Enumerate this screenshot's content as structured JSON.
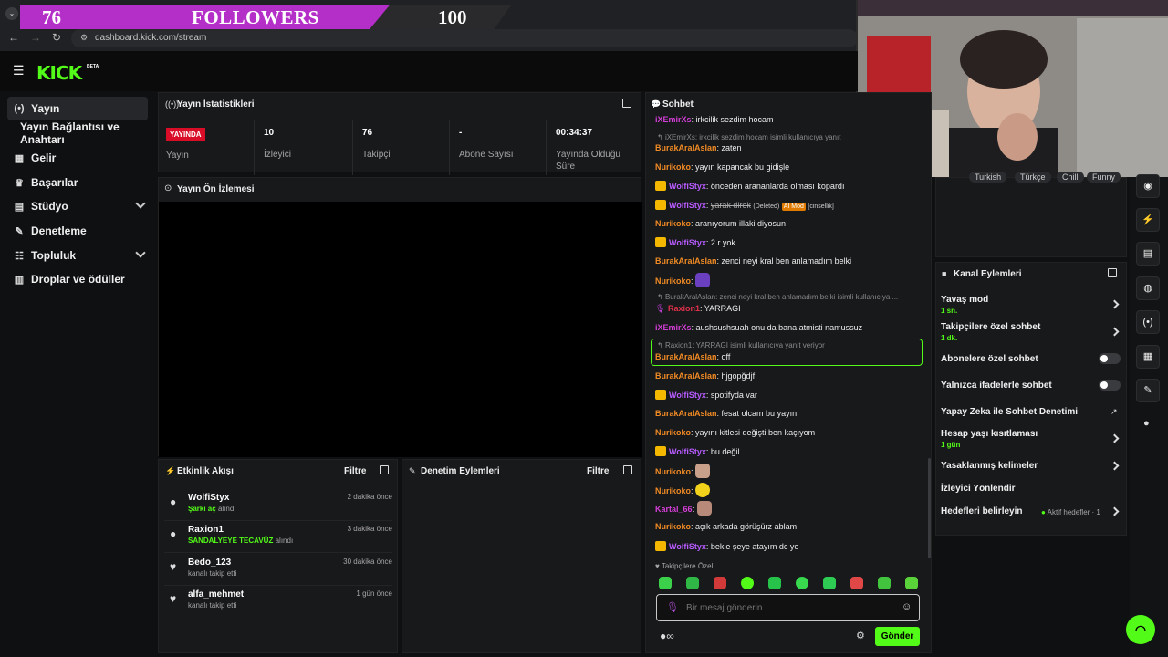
{
  "overlay": {
    "count_current": "76",
    "label": "FOLLOWERS",
    "count_goal": "100"
  },
  "browser": {
    "url": "dashboard.kick.com/stream"
  },
  "sidebar": {
    "items": [
      {
        "label": "Yayın"
      },
      {
        "label": "Yayın Bağlantısı ve Anahtarı"
      },
      {
        "label": "Gelir"
      },
      {
        "label": "Başarılar"
      },
      {
        "label": "Stüdyo"
      },
      {
        "label": "Denetleme"
      },
      {
        "label": "Topluluk"
      },
      {
        "label": "Droplar ve ödüller"
      }
    ]
  },
  "stats": {
    "title": "Yayın İstatistikleri",
    "live_badge": "YAYINDA",
    "live_label": "Yayın",
    "viewers_value": "10",
    "viewers_label": "İzleyici",
    "followers_value": "76",
    "followers_label": "Takipçi",
    "subs_value": "-",
    "subs_label": "Abone Sayısı",
    "uptime_value": "00:34:37",
    "uptime_label": "Yayında Olduğu Süre"
  },
  "preview": {
    "title": "Yayın Ön İzlemesi"
  },
  "activity": {
    "title": "Etkinlik Akışı",
    "filter": "Filtre",
    "items": [
      {
        "name": "WolfiStyx",
        "highlight": "Şarkı aç",
        "suffix": "alındı",
        "time": "2 dakika önce"
      },
      {
        "name": "Raxion1",
        "highlight": "SANDALYEYE TECAVÜZ",
        "suffix": "alındı",
        "time": "3 dakika önce"
      },
      {
        "name": "Bedo_123",
        "highlight": "",
        "suffix": "kanalı takip etti",
        "time": "30 dakika önce"
      },
      {
        "name": "alfa_mehmet",
        "highlight": "",
        "suffix": "kanalı takip etti",
        "time": "1 gün önce"
      }
    ]
  },
  "moderation": {
    "title": "Denetim Eylemleri",
    "filter": "Filtre"
  },
  "chat": {
    "title": "Sohbet",
    "lines": [
      {
        "user": "iXEmirXs",
        "text": ": irkcilik sezdim hocam"
      },
      {
        "reply": "iXEmirXs: irkcilik sezdim hocam isimli kullanıcıya yanıt"
      },
      {
        "user": "BurakAralAslan",
        "text": ": zaten"
      },
      {
        "user": "Nurikoko",
        "text": ": yayın kapancak bu gidişle"
      },
      {
        "user": "WolfiStyx",
        "text": ": önceden arananlarda olması kopardı"
      },
      {
        "user": "WolfiStyx",
        "text": "yarak direk",
        "deleted": "(Deleted)",
        "ai": "AI Mod",
        "cat": "[cinsellik]"
      },
      {
        "user": "Nurikoko",
        "text": ": aranıyorum illaki diyosun"
      },
      {
        "user": "WolfiStyx",
        "text": ": 2 r yok"
      },
      {
        "user": "BurakAralAslan",
        "text": ": zenci neyi kral ben anlamadım belki"
      },
      {
        "user": "Nurikoko",
        "text": ":"
      },
      {
        "reply": "BurakAralAslan: zenci neyi kral ben anlamadım belki isimli kullanıcıya ..."
      },
      {
        "user": "Raxion1",
        "text": ": YARRAGI"
      },
      {
        "user": "iXEmirXs",
        "text": ": aushsushsuah onu da bana atmisti namussuz"
      },
      {
        "reply": "Raxion1: YARRAGI isimli kullanıcıya yanıt veriyor"
      },
      {
        "user": "BurakAralAslan",
        "text": ": off"
      },
      {
        "user": "BurakAralAslan",
        "text": ": hjgopğdjf"
      },
      {
        "user": "WolfiStyx",
        "text": ": spotifyda var"
      },
      {
        "user": "BurakAralAslan",
        "text": ": fesat olcam bu yayın"
      },
      {
        "user": "Nurikoko",
        "text": ": yayını kitlesi değişti ben kaçıyom"
      },
      {
        "user": "WolfiStyx",
        "text": ": bu değil"
      },
      {
        "user": "Nurikoko",
        "text": ":"
      },
      {
        "user": "Nurikoko",
        "text": ":"
      },
      {
        "user": "Kartal_66",
        "text": ":"
      },
      {
        "user": "Nurikoko",
        "text": ": açık arkada görüşürz ablam"
      },
      {
        "user": "WolfiStyx",
        "text": ": bekle şeye atayım dc ye"
      }
    ],
    "followers_only": "Takipçilere Özel",
    "input_placeholder": "Bir mesaj gönderin",
    "send": "Gönder"
  },
  "channel_actions": {
    "title": "Kanal Eylemleri",
    "slow_mode": "Yavaş mod",
    "slow_mode_value": "1 sn.",
    "followers_chat": "Takipçilere özel sohbet",
    "followers_chat_value": "1 dk.",
    "subs_chat": "Abonelere özel sohbet",
    "emotes_chat": "Yalnızca ifadelerle sohbet",
    "ai_moderation": "Yapay Zeka ile Sohbet Denetimi",
    "age_limit": "Hesap yaşı kısıtlaması",
    "age_limit_value": "1 gün",
    "banned_words": "Yasaklanmış kelimeler",
    "redirect": "İzleyici Yönlendir",
    "goals": "Hedefleri belirleyin",
    "goals_status": "Aktif hedefler · 1"
  },
  "tags": [
    "Turkish",
    "Türkçe",
    "Chill",
    "Funny"
  ],
  "colors": {
    "brand": "#53fc18",
    "live": "#d90d27",
    "overlay_purple": "#b42fc7"
  }
}
